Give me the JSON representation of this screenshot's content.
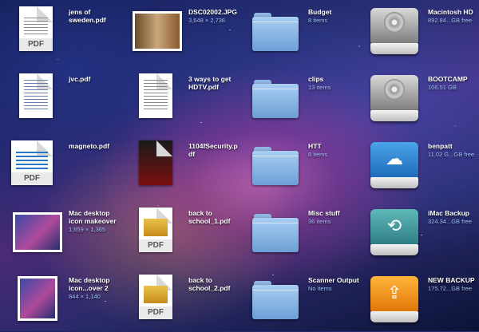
{
  "files": [
    {
      "name": "jens of sweden.pdf",
      "info": ""
    },
    {
      "name": "jvc.pdf",
      "info": ""
    },
    {
      "name": "magneto.pdf",
      "info": ""
    },
    {
      "name": "Mac desktop icon makeover",
      "info": "1,659 × 1,365"
    },
    {
      "name": "Mac desktop icon...over 2",
      "info": "844 × 1,140"
    },
    {
      "name": "DSC02002.JPG",
      "info": "3,648 × 2,736"
    },
    {
      "name": "3 ways to get HDTV.pdf",
      "info": ""
    },
    {
      "name": "1104fSecurity.pdf",
      "info": ""
    },
    {
      "name": "back to school_1.pdf",
      "info": ""
    },
    {
      "name": "back to school_2.pdf",
      "info": ""
    }
  ],
  "folders": [
    {
      "name": "Budget",
      "info": "8 items"
    },
    {
      "name": "clips",
      "info": "13 items"
    },
    {
      "name": "HTT",
      "info": "8 items"
    },
    {
      "name": "Misc stuff",
      "info": "36 items"
    },
    {
      "name": "Scanner Output",
      "info": "No items"
    }
  ],
  "drives": [
    {
      "name": "Macintosh HD",
      "info": "892.84...GB free",
      "color": "#8a8a8a",
      "icon": "hard-drive-icon"
    },
    {
      "name": "BOOTCAMP",
      "info": "106.51 GB",
      "color": "#8a8a8a",
      "icon": "hard-drive-icon"
    },
    {
      "name": "benpatt",
      "info": "11.02 G...GB free",
      "color": "#2f86d6",
      "icon": "cloud-drive-icon"
    },
    {
      "name": "iMac Backup",
      "info": "324.34...GB free",
      "color": "#3a9199",
      "icon": "time-machine-drive-icon"
    },
    {
      "name": "NEW BACKUP",
      "info": "175.72...GB free",
      "color": "#f39a1e",
      "icon": "usb-drive-icon"
    }
  ],
  "pdf_tag": "PDF"
}
